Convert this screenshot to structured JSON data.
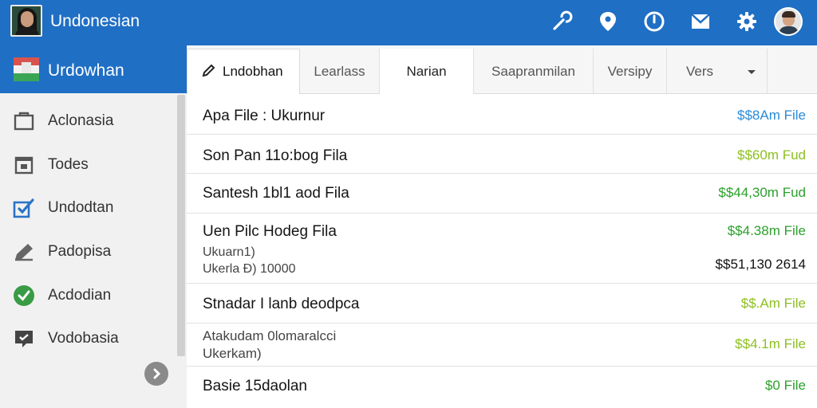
{
  "app": {
    "title": "Undonesian"
  },
  "topbar": {
    "icons": [
      "wrench-icon",
      "location-pin-icon",
      "clock-icon",
      "inbox-icon",
      "gear-icon",
      "user-avatar"
    ]
  },
  "sidebar": {
    "header_label": "Urdowhan",
    "items": [
      {
        "label": "Aclonasia",
        "icon": "folder-icon"
      },
      {
        "label": "Todes",
        "icon": "calendar-icon"
      },
      {
        "label": "Undodtan",
        "icon": "edit-check-icon"
      },
      {
        "label": "Padopisa",
        "icon": "pencil-icon"
      },
      {
        "label": "Acdodian",
        "icon": "check-circle-icon"
      },
      {
        "label": "Vodobasia",
        "icon": "chat-icon"
      }
    ],
    "more_icon": "chevron-right-icon"
  },
  "tabs": [
    {
      "label": "Lndobhan",
      "active": true
    },
    {
      "label": "Learlass"
    },
    {
      "label": "Narian"
    },
    {
      "label": "Saapranmilan"
    },
    {
      "label": "Versipy"
    },
    {
      "label": "Vers",
      "dropdown": true
    }
  ],
  "rows": [
    {
      "title": "Apa File : Ukurnur",
      "value": "$$8Am File",
      "value_color": "#2b8ad6"
    },
    {
      "title": "Son Pan 11o:bog Fila",
      "value": "$$60m Fud",
      "value_color": "#8dbf1f"
    },
    {
      "title": "Santesh 1bl1 aod Fila",
      "value": "$$44,30m Fud",
      "value_color": "#2ca02c"
    },
    {
      "title": "Uen Pilc Hodeg Fila",
      "sub1": "Ukuarn1)",
      "sub2": "Ukerla Ð)  10000",
      "value": "$$4.38m File",
      "value_color": "#2ca02c",
      "value2": "$$51,130 2614"
    },
    {
      "title": "Stnadar I lanb deodpca",
      "value": "$$.Am File",
      "value_color": "#8dbf1f"
    },
    {
      "title": "Atakudam 0lomaralcci",
      "sub1": "Ukerkam)",
      "value": "$$4.1m File",
      "value_color": "#8dbf1f",
      "small_title": true
    },
    {
      "title": "Basie 15daolan",
      "value": "$0 File",
      "value_color": "#2ca02c"
    }
  ]
}
